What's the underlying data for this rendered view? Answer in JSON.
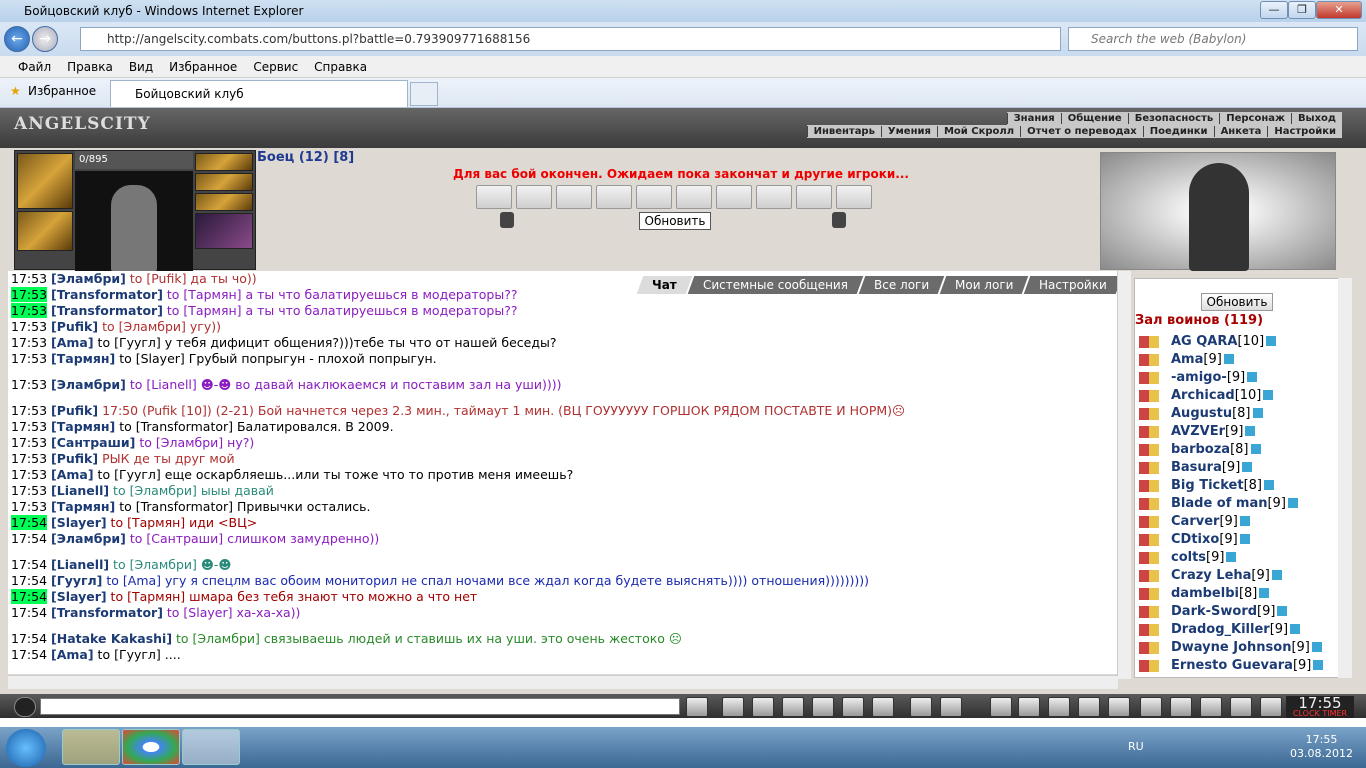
{
  "window": {
    "title": "Бойцовский клуб - Windows Internet Explorer",
    "min": "—",
    "max": "❐",
    "close": "✕"
  },
  "browser": {
    "url": "http://angelscity.combats.com/buttons.pl?battle=0.793909771688156",
    "search_placeholder": "Search the web (Babylon)",
    "back": "←",
    "fwd": "→"
  },
  "menu": [
    "Файл",
    "Правка",
    "Вид",
    "Избранное",
    "Сервис",
    "Справка"
  ],
  "favorites_label": "Избранное",
  "tab_label": "Бойцовский клуб",
  "game": {
    "logo": "ANGELSCITY",
    "top_links": [
      "Знания",
      "Общение",
      "Безопасность",
      "Персонаж",
      "Выход"
    ],
    "sub_links": [
      "Инвентарь",
      "Умения",
      "Мой Скролл",
      "Отчет о переводах",
      "Поединки",
      "Анкета",
      "Настройки"
    ],
    "hp": "0/895",
    "fighter": "Боец (12) [8]",
    "battle_message": "Для вас бой окончен. Ожидаем пока закончат и другие игроки...",
    "refresh": "Обновить",
    "chat_tabs": [
      "Чат",
      "Системные сообщения",
      "Все логи",
      "Мои логи",
      "Настройки"
    ],
    "chat": [
      {
        "time": "17:53",
        "hl": false,
        "name": "[Эламбри]",
        "rest": " to [Pufik] да ты чо))",
        "color": "#b03030"
      },
      {
        "time": "17:53",
        "hl": true,
        "name": "[Transformator]",
        "rest": " to [Тармян] а ты что балатируешься в модераторы??",
        "color": "#8a1cc0",
        "to_bold": true
      },
      {
        "time": "17:53",
        "hl": true,
        "name": "[Transformator]",
        "rest": " to [Тармян] а ты что балатируешься в модераторы??",
        "color": "#8a1cc0",
        "to_bold": true
      },
      {
        "time": "17:53",
        "hl": false,
        "name": "[Pufik]",
        "rest": " to [Эламбри] угу))",
        "color": "#b03030"
      },
      {
        "time": "17:53",
        "hl": false,
        "name": "[Ama]",
        "rest": " to [Гуугл] у тебя дифицит общения?)))тебе ты что от нашей беседы?",
        "color": "#000"
      },
      {
        "time": "17:53",
        "hl": false,
        "name": "[Тармян]",
        "rest": " to [Slayer] Грубый попрыгун - плохой попрыгун.",
        "color": "#000"
      },
      {
        "gap": true
      },
      {
        "time": "17:53",
        "hl": false,
        "name": "[Эламбри]",
        "rest": " to [Lianell]   ☻-☻   во давай наклюкаемся и поставим зал на уши))))",
        "color": "#8a1cc0"
      },
      {
        "gap": true
      },
      {
        "time": "17:53",
        "hl": false,
        "name": "[Pufik]",
        "rest": " 17:50 (Pufik [10]) (2-21) Бой начнется через 2.3 мин., таймаут 1 мин. (ВЦ ГОУУУУУУ ГОРШОК РЯДОМ ПОСТАВТЕ И НОРМ)☹",
        "color": "#b03030"
      },
      {
        "time": "17:53",
        "hl": false,
        "name": "[Тармян]",
        "rest": " to [Transformator] Балатировался. В 2009.",
        "color": "#000"
      },
      {
        "time": "17:53",
        "hl": false,
        "name": "[Сантраши]",
        "rest": " to [Эламбри] ну?)",
        "color": "#8a1cc0"
      },
      {
        "time": "17:53",
        "hl": false,
        "name": "[Pufik]",
        "rest": " РЫК де ты друг мой",
        "color": "#b03030"
      },
      {
        "time": "17:53",
        "hl": false,
        "name": "[Ama]",
        "rest": " to [Гуугл] еще оскарбляешь...или ты тоже что то против меня имеешь?",
        "color": "#000"
      },
      {
        "time": "17:53",
        "hl": false,
        "name": "[Lianell]",
        "rest": " to [Эламбри] ыыы давай",
        "color": "#2a8a7a"
      },
      {
        "time": "17:53",
        "hl": false,
        "name": "[Тармян]",
        "rest": " to [Transformator] Привычки остались.",
        "color": "#000"
      },
      {
        "time": "17:54",
        "hl": true,
        "name": "[Slayer]",
        "rest": " to [Тармян] иди <ВЦ>",
        "color": "#a00000",
        "to_bold": true
      },
      {
        "time": "17:54",
        "hl": false,
        "name": "[Эламбри]",
        "rest": " to [Сантраши] слишком замудренно))",
        "color": "#8a1cc0"
      },
      {
        "gap": true
      },
      {
        "time": "17:54",
        "hl": false,
        "name": "[Lianell]",
        "rest": " to [Эламбри]  ☻-☻",
        "color": "#2a8a7a"
      },
      {
        "time": "17:54",
        "hl": false,
        "name": "[Гуугл]",
        "rest": " to [Ama] угу я спецлм вас обоим мониторил не спал ночами все ждал когда будете выяснять)))) отношения)))))))))",
        "color": "#1a2ab0"
      },
      {
        "time": "17:54",
        "hl": true,
        "name": "[Slayer]",
        "rest": " to [Тармян] шмара без тебя знают что можно а что нет",
        "color": "#a00000",
        "to_bold": true
      },
      {
        "time": "17:54",
        "hl": false,
        "name": "[Transformator]",
        "rest": " to [Slayer] ха-ха-ха))",
        "color": "#8a1cc0"
      },
      {
        "gap": true
      },
      {
        "time": "17:54",
        "hl": false,
        "name": "[Hatake Kakashi]",
        "rest": " to [Эламбри] связываешь людей и ставишь их на уши. это очень жестоко ☹",
        "color": "#2a8a2a"
      },
      {
        "time": "17:54",
        "hl": false,
        "name": "[Ama]",
        "rest": " to [Гуугл] ....",
        "color": "#000"
      }
    ],
    "hall_title": "Зал воинов (119)",
    "players": [
      {
        "n": "AG QARA",
        "l": "[10]"
      },
      {
        "n": "Ama",
        "l": "[9]"
      },
      {
        "n": "-amigo-",
        "l": "[9]"
      },
      {
        "n": "Archicad",
        "l": "[10]"
      },
      {
        "n": "Augustu",
        "l": "[8]"
      },
      {
        "n": "AVZVEr",
        "l": "[9]"
      },
      {
        "n": "barboza",
        "l": "[8]"
      },
      {
        "n": "Basura",
        "l": "[9]"
      },
      {
        "n": "Big Ticket",
        "l": "[8]"
      },
      {
        "n": "Blade of man",
        "l": "[9]"
      },
      {
        "n": "Carver",
        "l": "[9]"
      },
      {
        "n": "CDtixo",
        "l": "[9]"
      },
      {
        "n": "colts",
        "l": "[9]"
      },
      {
        "n": "Crazy Leha",
        "l": "[9]"
      },
      {
        "n": "dambelbi",
        "l": "[8]"
      },
      {
        "n": "Dark-Sword",
        "l": "[9]"
      },
      {
        "n": "Dradog_Killer",
        "l": "[9]"
      },
      {
        "n": "Dwayne Johnson",
        "l": "[9]"
      },
      {
        "n": "Ernesto Guevara",
        "l": "[9]"
      }
    ],
    "clock": "17:55",
    "clock_sub": "CLOCK TIMER"
  },
  "taskbar": {
    "lang": "RU",
    "time": "17:55",
    "date": "03.08.2012"
  }
}
